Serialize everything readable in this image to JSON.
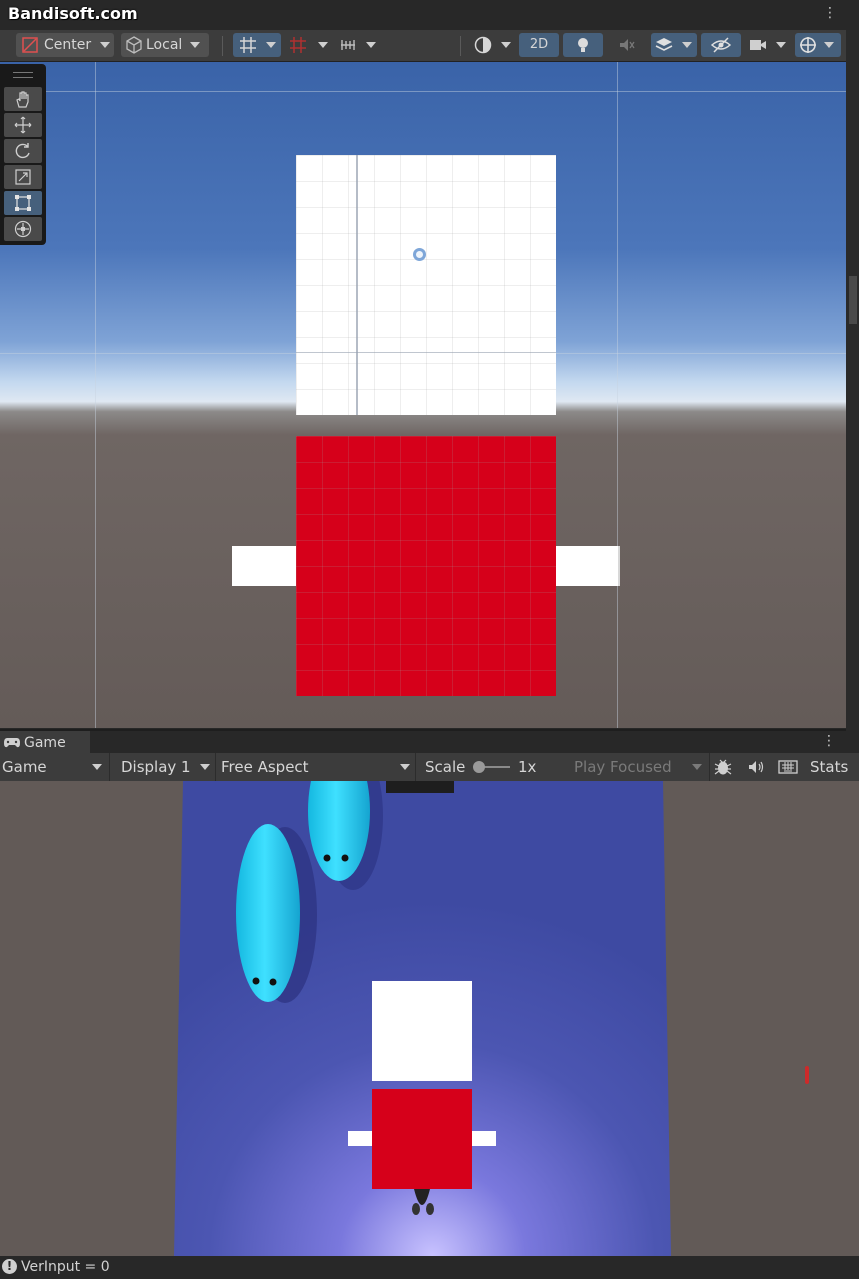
{
  "watermark": "Bandisoft.com",
  "scene_toolbar": {
    "pivot_mode": "Center",
    "pivot_rotation": "Local",
    "mode_2d": "2D",
    "icons": [
      "pivot-icon",
      "local-cube-icon",
      "grid-snap-icon",
      "increment-snap-icon",
      "ruler-icon",
      "shading-icon",
      "light-icon",
      "audio-icon",
      "effects-icon",
      "visibility-icon",
      "camera-icon",
      "gizmo-icon"
    ]
  },
  "tools": [
    "hand-tool",
    "move-tool",
    "rotate-tool",
    "scale-tool",
    "rect-tool",
    "transform-tool"
  ],
  "active_tool": "rect-tool",
  "game_panel": {
    "tab_label": "Game",
    "mode_select": "Game",
    "display_select": "Display 1",
    "aspect_select": "Free Aspect",
    "scale_label": "Scale",
    "scale_value": "1x",
    "play_mode": "Play Focused",
    "stats_label": "Stats"
  },
  "status": {
    "message": "VerInput = 0"
  },
  "colors": {
    "red_block": "#d6001a",
    "white_block": "#ffffff",
    "floor_blue": "#4150a6",
    "fish": "#22ccf0",
    "active_accent": "#46607c"
  }
}
